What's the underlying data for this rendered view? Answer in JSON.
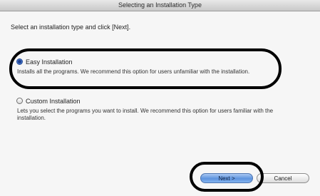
{
  "window": {
    "title": "Selecting an Installation Type"
  },
  "instruction": "Select an installation type and click [Next].",
  "options": [
    {
      "label": "Easy Installation",
      "description": "Installs all the programs. We recommend this option for users unfamiliar with the installation.",
      "selected": true
    },
    {
      "label": "Custom Installation",
      "description": "Lets you select the programs you want to install. We recommend this option for users familiar with the installation.",
      "selected": false
    }
  ],
  "buttons": {
    "next": "Next >",
    "cancel": "Cancel"
  },
  "colors": {
    "highlight": "#000000",
    "next_button": "#5d93de"
  }
}
